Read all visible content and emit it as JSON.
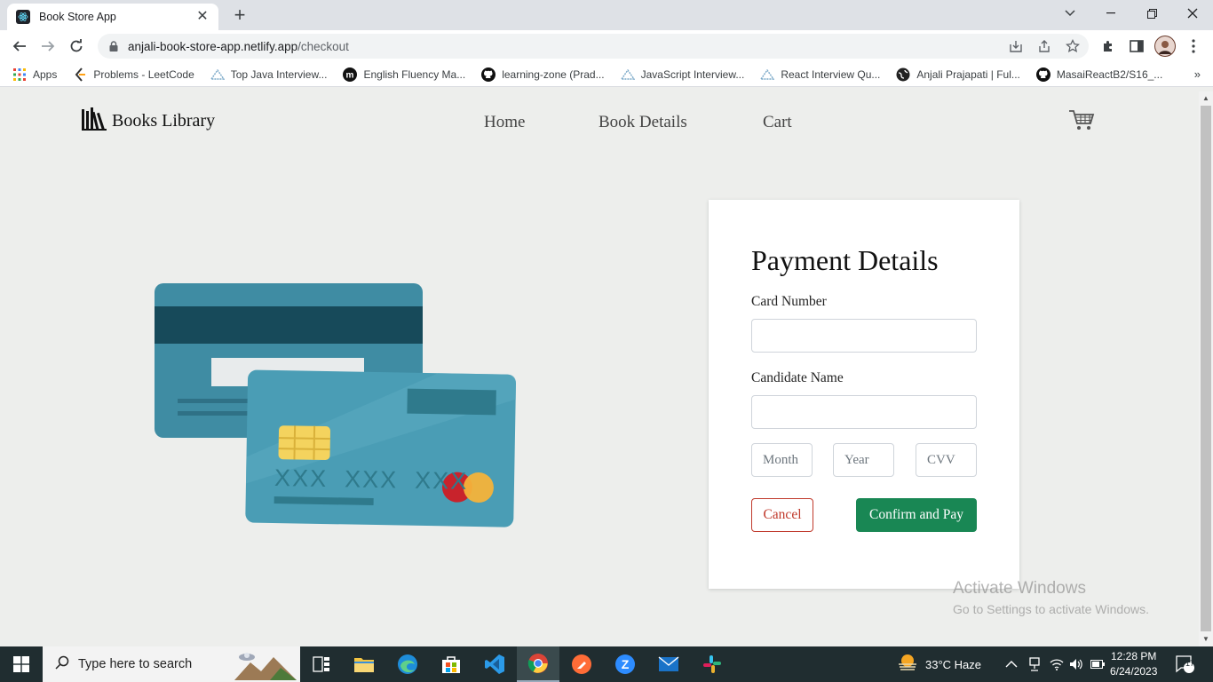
{
  "browser": {
    "tab_title": "Book Store App",
    "tab_close": "✕",
    "new_tab": "+",
    "url_host": "anjali-book-store-app.netlify.app",
    "url_path": "/checkout",
    "bookmarks": [
      {
        "label": "Apps",
        "icon": "apps-grid-icon"
      },
      {
        "label": "Problems - LeetCode",
        "icon": "leetcode-icon"
      },
      {
        "label": "Top Java Interview...",
        "icon": "bookmark-site-icon"
      },
      {
        "label": "English Fluency Ma...",
        "icon": "medium-icon"
      },
      {
        "label": "learning-zone (Prad...",
        "icon": "github-icon"
      },
      {
        "label": "JavaScript Interview...",
        "icon": "bookmark-site-icon"
      },
      {
        "label": "React Interview Qu...",
        "icon": "bookmark-site-icon"
      },
      {
        "label": "Anjali Prajapati | Ful...",
        "icon": "globe-icon"
      },
      {
        "label": "MasaiReactB2/S16_...",
        "icon": "github-icon"
      }
    ],
    "bookmarks_more": "»"
  },
  "site": {
    "brand": "Books Library",
    "nav": [
      {
        "label": "Home"
      },
      {
        "label": "Book Details"
      },
      {
        "label": "Cart"
      }
    ]
  },
  "payment": {
    "title": "Payment Details",
    "card_number_label": "Card Number",
    "card_number_value": "",
    "name_label": "Candidate Name",
    "name_value": "",
    "month_placeholder": "Month",
    "year_placeholder": "Year",
    "cvv_placeholder": "CVV",
    "cancel_label": "Cancel",
    "confirm_label": "Confirm and Pay"
  },
  "illustration": {
    "card_digits": "XXX  XXX  XXX"
  },
  "watermark": {
    "line1": "Activate Windows",
    "line2": "Go to Settings to activate Windows."
  },
  "taskbar": {
    "search_placeholder": "Type here to search",
    "weather": "33°C  Haze",
    "time": "12:28 PM",
    "date": "6/24/2023",
    "notifications": "17"
  },
  "colors": {
    "primary_green": "#198754",
    "cancel_red": "#c0392b",
    "card_teal": "#4a9db5",
    "page_bg": "#edeeec"
  }
}
